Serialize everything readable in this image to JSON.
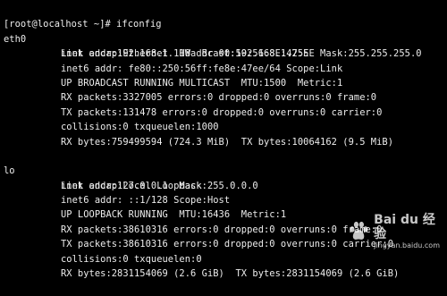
{
  "terminal": {
    "prompt": "[root@localhost ~]# ifconfig",
    "interfaces": [
      {
        "name": "eth0",
        "lines": [
          "Link encap:Ethernet  HWaddr 00:50:56:8E:47:EE",
          "inet addr:192.168.1.118  Bcast:192.168.1.255  Mask:255.255.255.0",
          "inet6 addr: fe80::250:56ff:fe8e:47ee/64 Scope:Link",
          "UP BROADCAST RUNNING MULTICAST  MTU:1500  Metric:1",
          "RX packets:3327005 errors:0 dropped:0 overruns:0 frame:0",
          "TX packets:131478 errors:0 dropped:0 overruns:0 carrier:0",
          "collisions:0 txqueuelen:1000",
          "RX bytes:759499594 (724.3 MiB)  TX bytes:10064162 (9.5 MiB)"
        ]
      },
      {
        "name": "lo",
        "lines": [
          "Link encap:Local Loopback",
          "inet addr:127.0.0.1  Mask:255.0.0.0",
          "inet6 addr: ::1/128 Scope:Host",
          "UP LOOPBACK RUNNING  MTU:16436  Metric:1",
          "RX packets:38610316 errors:0 dropped:0 overruns:0 frame:0",
          "TX packets:38610316 errors:0 dropped:0 overruns:0 carrier:0",
          "collisions:0 txqueuelen:0",
          "RX bytes:2831154069 (2.6 GiB)  TX bytes:2831154069 (2.6 GiB)"
        ]
      }
    ]
  },
  "watermark": {
    "brand": "Bai du 经验",
    "sub": "jingyan.baidu.com"
  },
  "colors": {
    "background": "#000000",
    "foreground": "#ededed"
  }
}
